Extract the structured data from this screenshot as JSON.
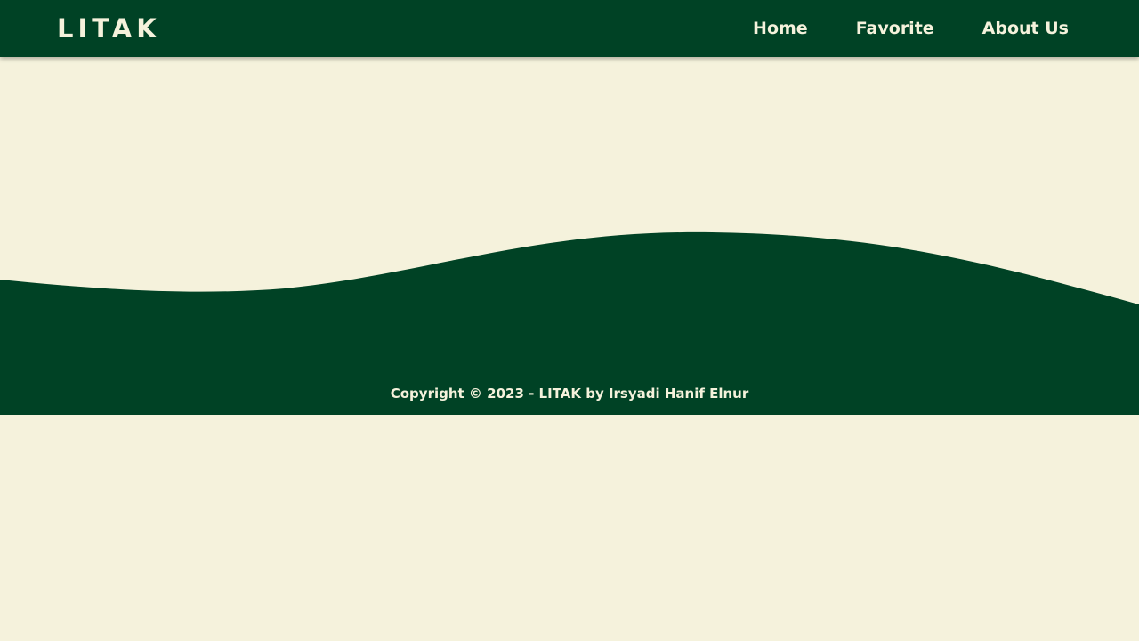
{
  "navbar": {
    "brand": "LITAK",
    "links": [
      {
        "label": "Home"
      },
      {
        "label": "Favorite"
      },
      {
        "label": "About Us"
      }
    ]
  },
  "footer": {
    "copyright": "Copyright © 2023 - LITAK by Irsyadi Hanif Elnur"
  },
  "colors": {
    "primary": "#004225",
    "background": "#f5f2dc",
    "text_light": "#f5f2dc"
  }
}
